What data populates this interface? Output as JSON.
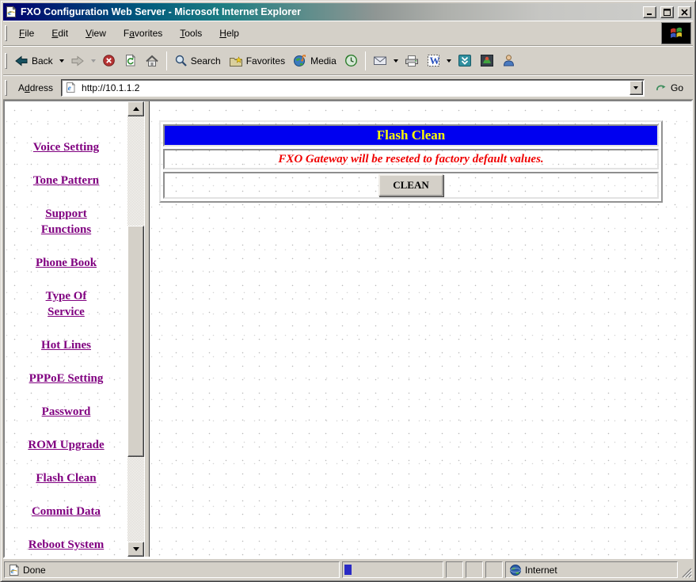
{
  "window": {
    "title": "FXO Configuration Web Server - Microsoft Internet Explorer"
  },
  "menu": {
    "items": [
      {
        "pre": "",
        "key": "F",
        "post": "ile"
      },
      {
        "pre": "",
        "key": "E",
        "post": "dit"
      },
      {
        "pre": "",
        "key": "V",
        "post": "iew"
      },
      {
        "pre": "F",
        "key": "a",
        "post": "vorites"
      },
      {
        "pre": "",
        "key": "T",
        "post": "ools"
      },
      {
        "pre": "",
        "key": "H",
        "post": "elp"
      }
    ]
  },
  "toolbar": {
    "back_label": "Back",
    "search_label": "Search",
    "favorites_label": "Favorites",
    "media_label": "Media"
  },
  "address": {
    "pre": "A",
    "key": "d",
    "post": "dress",
    "value": "http://10.1.1.2",
    "go_label": "Go"
  },
  "sidebar": {
    "links": [
      "Voice Setting",
      "Tone Pattern",
      "Support\nFunctions",
      "Phone Book",
      "Type Of\nService",
      "Hot Lines",
      "PPPoE Setting",
      "Password",
      "ROM Upgrade",
      "Flash Clean",
      "Commit Data",
      "Reboot System"
    ]
  },
  "panel": {
    "title": "Flash Clean",
    "warning": "FXO Gateway will be reseted to factory default values.",
    "button_label": "CLEAN"
  },
  "status": {
    "done": "Done",
    "zone": "Internet"
  },
  "icons": {
    "titlebar": [
      "ie-page-icon",
      "minimize-icon",
      "maximize-icon",
      "close-icon"
    ],
    "menubar": [
      "windows-flag-throbber"
    ],
    "toolbar": [
      "back-arrow-icon",
      "forward-arrow-icon",
      "stop-icon",
      "refresh-icon",
      "home-icon",
      "search-magnifier-icon",
      "favorites-folder-star-icon",
      "media-globe-note-icon",
      "history-clock-icon",
      "mail-envelope-icon",
      "printer-icon",
      "edit-word-icon",
      "chevron-panel-icon",
      "msn-icon",
      "messenger-person-icon"
    ],
    "address": [
      "page-icon",
      "dropdown-arrow",
      "go-curved-arrow"
    ],
    "statusbar": [
      "ie-page-icon",
      "internet-globe-icon",
      "resize-grip"
    ]
  },
  "colors": {
    "chrome": "#d4d0c8",
    "titlebar_gradient_start": "#000080",
    "titlebar_gradient_mid": "#1d7d82",
    "titlebar_gradient_end": "#cfcfcc",
    "panel_header_bg": "#0000f0",
    "panel_header_text": "#ffff00",
    "warning_text": "#f00000",
    "sidebar_link": "#800080",
    "progress_chunk": "#2a2ac4"
  }
}
